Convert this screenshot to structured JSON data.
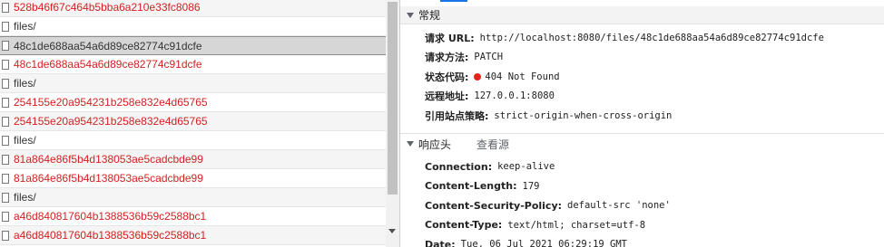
{
  "requests": [
    {
      "name": "528b46f67c464b5bba6a210e33fc8086",
      "status": "error"
    },
    {
      "name": "files/",
      "status": "ok"
    },
    {
      "name": "48c1de688aa54a6d89ce82774c91dcfe",
      "status": "selected"
    },
    {
      "name": "48c1de688aa54a6d89ce82774c91dcfe",
      "status": "error"
    },
    {
      "name": "files/",
      "status": "ok"
    },
    {
      "name": "254155e20a954231b258e832e4d65765",
      "status": "error"
    },
    {
      "name": "254155e20a954231b258e832e4d65765",
      "status": "error"
    },
    {
      "name": "files/",
      "status": "ok"
    },
    {
      "name": "81a864e86f5b4d138053ae5cadcbde99",
      "status": "error"
    },
    {
      "name": "81a864e86f5b4d138053ae5cadcbde99",
      "status": "error"
    },
    {
      "name": "files/",
      "status": "ok"
    },
    {
      "name": "a46d840817604b1388536b59c2588bc1",
      "status": "error"
    },
    {
      "name": "a46d840817604b1388536b59c2588bc1",
      "status": "error"
    }
  ],
  "general": {
    "title": "常规",
    "request_url_label": "请求 URL:",
    "request_url": "http://localhost:8080/files/48c1de688aa54a6d89ce82774c91dcfe",
    "method_label": "请求方法:",
    "method": "PATCH",
    "status_label": "状态代码:",
    "status": "404 Not Found",
    "remote_label": "远程地址:",
    "remote": "127.0.0.1:8080",
    "referrer_label": "引用站点策略:",
    "referrer": "strict-origin-when-cross-origin"
  },
  "response_headers": {
    "title": "响应头",
    "view_source": "查看源",
    "items": [
      {
        "key": "Connection:",
        "value": "keep-alive"
      },
      {
        "key": "Content-Length:",
        "value": "179"
      },
      {
        "key": "Content-Security-Policy:",
        "value": "default-src 'none'"
      },
      {
        "key": "Content-Type:",
        "value": "text/html; charset=utf-8"
      },
      {
        "key": "Date:",
        "value": "Tue, 06 Jul 2021 06:29:19 GMT"
      }
    ]
  },
  "colors": {
    "error_text": "#d42020",
    "status_dot": "#e0241b",
    "selected_row": "#d6d6d6"
  }
}
